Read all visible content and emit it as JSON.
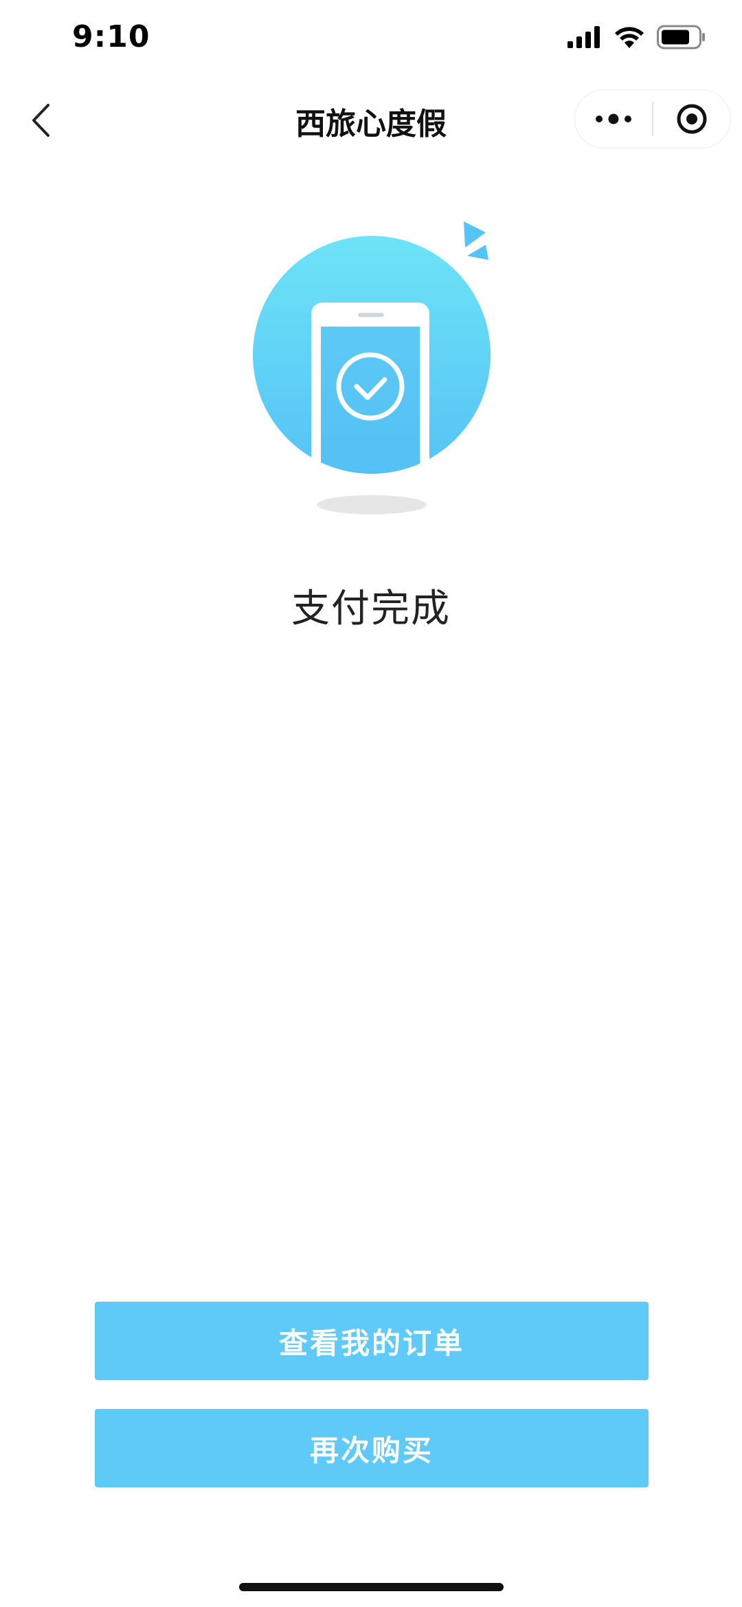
{
  "status_bar": {
    "time": "9:10",
    "icons": [
      "signal-icon",
      "wifi-icon",
      "battery-icon"
    ]
  },
  "nav": {
    "title": "西旅心度假",
    "icons": [
      "back-chevron-icon",
      "more-dots-icon",
      "target-circle-icon"
    ]
  },
  "result": {
    "message": "支付完成",
    "illustration_icon": "phone-check-icon"
  },
  "actions": {
    "view_orders_label": "查看我的订单",
    "buy_again_label": "再次购买"
  },
  "colors": {
    "accent": "#5fcaf7",
    "circle_top": "#6ee3f7",
    "circle_bottom": "#55c3f5"
  }
}
